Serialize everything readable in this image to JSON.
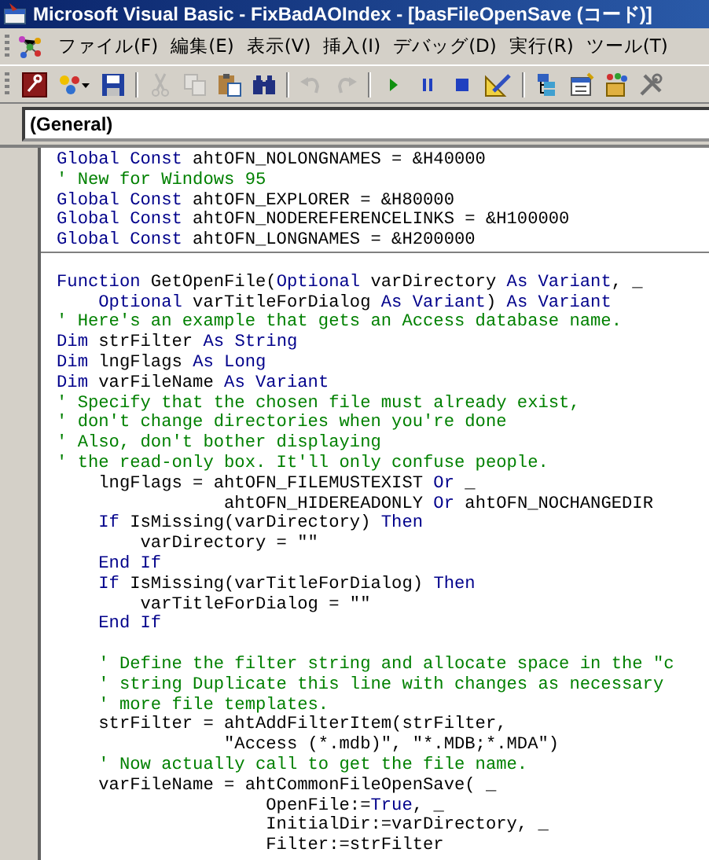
{
  "window": {
    "title": "Microsoft Visual Basic - FixBadAOIndex - [basFileOpenSave (コード)]"
  },
  "menu": [
    "ファイル(F)",
    "編集(E)",
    "表示(V)",
    "挿入(I)",
    "デバッグ(D)",
    "実行(R)",
    "ツール(T)"
  ],
  "toolbar": [
    {
      "kind": "access",
      "disabled": false
    },
    {
      "kind": "insert",
      "disabled": false
    },
    {
      "kind": "save",
      "disabled": false
    },
    {
      "kind": "sep"
    },
    {
      "kind": "cut",
      "disabled": true
    },
    {
      "kind": "copy",
      "disabled": true
    },
    {
      "kind": "paste",
      "disabled": false
    },
    {
      "kind": "find",
      "disabled": false
    },
    {
      "kind": "sep"
    },
    {
      "kind": "undo",
      "disabled": true
    },
    {
      "kind": "redo",
      "disabled": true
    },
    {
      "kind": "sep"
    },
    {
      "kind": "run",
      "disabled": false
    },
    {
      "kind": "pause",
      "disabled": false
    },
    {
      "kind": "stop",
      "disabled": false
    },
    {
      "kind": "design",
      "disabled": false
    },
    {
      "kind": "sep"
    },
    {
      "kind": "project",
      "disabled": false
    },
    {
      "kind": "properties",
      "disabled": false
    },
    {
      "kind": "browser",
      "disabled": false
    },
    {
      "kind": "toolbox",
      "disabled": false
    }
  ],
  "object_box": {
    "value": "(General)"
  },
  "sections": [
    {
      "lines": [
        {
          "tokens": [
            {
              "text": "Global Const",
              "kind": "keyword"
            },
            {
              "text": " ahtOFN_NOLONGNAMES = &H40000",
              "kind": "plain"
            }
          ]
        },
        {
          "tokens": [
            {
              "text": "' New for Windows 95",
              "kind": "comment"
            }
          ]
        },
        {
          "tokens": [
            {
              "text": "Global Const",
              "kind": "keyword"
            },
            {
              "text": " ahtOFN_EXPLORER = &H80000",
              "kind": "plain"
            }
          ]
        },
        {
          "tokens": [
            {
              "text": "Global Const",
              "kind": "keyword"
            },
            {
              "text": " ahtOFN_NODEREFERENCELINKS = &H100000",
              "kind": "plain"
            }
          ]
        },
        {
          "tokens": [
            {
              "text": "Global Const",
              "kind": "keyword"
            },
            {
              "text": " ahtOFN_LONGNAMES = &H200000",
              "kind": "plain"
            }
          ]
        }
      ]
    },
    {
      "lines": [
        {
          "blank": true
        },
        {
          "tokens": [
            {
              "text": "Function",
              "kind": "keyword"
            },
            {
              "text": " GetOpenFile(",
              "kind": "plain"
            },
            {
              "text": "Optional",
              "kind": "keyword"
            },
            {
              "text": " varDirectory ",
              "kind": "plain"
            },
            {
              "text": "As Variant",
              "kind": "keyword"
            },
            {
              "text": ", _",
              "kind": "plain"
            }
          ]
        },
        {
          "tokens": [
            {
              "text": "    Optional",
              "kind": "keyword"
            },
            {
              "text": " varTitleForDialog ",
              "kind": "plain"
            },
            {
              "text": "As Variant",
              "kind": "keyword"
            },
            {
              "text": ") ",
              "kind": "plain"
            },
            {
              "text": "As Variant",
              "kind": "keyword"
            }
          ]
        },
        {
          "tokens": [
            {
              "text": "' Here's an example that gets an Access database name.",
              "kind": "comment"
            }
          ]
        },
        {
          "tokens": [
            {
              "text": "Dim",
              "kind": "keyword"
            },
            {
              "text": " strFilter ",
              "kind": "plain"
            },
            {
              "text": "As String",
              "kind": "keyword"
            }
          ]
        },
        {
          "tokens": [
            {
              "text": "Dim",
              "kind": "keyword"
            },
            {
              "text": " lngFlags ",
              "kind": "plain"
            },
            {
              "text": "As Long",
              "kind": "keyword"
            }
          ]
        },
        {
          "tokens": [
            {
              "text": "Dim",
              "kind": "keyword"
            },
            {
              "text": " varFileName ",
              "kind": "plain"
            },
            {
              "text": "As Variant",
              "kind": "keyword"
            }
          ]
        },
        {
          "tokens": [
            {
              "text": "' Specify that the chosen file must already exist,",
              "kind": "comment"
            }
          ]
        },
        {
          "tokens": [
            {
              "text": "' don't change directories when you're done",
              "kind": "comment"
            }
          ]
        },
        {
          "tokens": [
            {
              "text": "' Also, don't bother displaying",
              "kind": "comment"
            }
          ]
        },
        {
          "tokens": [
            {
              "text": "' the read-only box. It'll only confuse people.",
              "kind": "comment"
            }
          ]
        },
        {
          "tokens": [
            {
              "text": "    lngFlags = ahtOFN_FILEMUSTEXIST ",
              "kind": "plain"
            },
            {
              "text": "Or",
              "kind": "keyword"
            },
            {
              "text": " _",
              "kind": "plain"
            }
          ]
        },
        {
          "tokens": [
            {
              "text": "                ahtOFN_HIDEREADONLY ",
              "kind": "plain"
            },
            {
              "text": "Or",
              "kind": "keyword"
            },
            {
              "text": " ahtOFN_NOCHANGEDIR",
              "kind": "plain"
            }
          ]
        },
        {
          "tokens": [
            {
              "text": "    If",
              "kind": "keyword"
            },
            {
              "text": " IsMissing(varDirectory) ",
              "kind": "plain"
            },
            {
              "text": "Then",
              "kind": "keyword"
            }
          ]
        },
        {
          "tokens": [
            {
              "text": "        varDirectory = \"\"",
              "kind": "plain"
            }
          ]
        },
        {
          "tokens": [
            {
              "text": "    End If",
              "kind": "keyword"
            }
          ]
        },
        {
          "tokens": [
            {
              "text": "    If",
              "kind": "keyword"
            },
            {
              "text": " IsMissing(varTitleForDialog) ",
              "kind": "plain"
            },
            {
              "text": "Then",
              "kind": "keyword"
            }
          ]
        },
        {
          "tokens": [
            {
              "text": "        varTitleForDialog = \"\"",
              "kind": "plain"
            }
          ]
        },
        {
          "tokens": [
            {
              "text": "    End If",
              "kind": "keyword"
            }
          ]
        },
        {
          "blank": true
        },
        {
          "tokens": [
            {
              "text": "    ' Define the filter string and allocate space in the \"c",
              "kind": "comment"
            }
          ]
        },
        {
          "tokens": [
            {
              "text": "    ' string Duplicate this line with changes as necessary",
              "kind": "comment"
            }
          ]
        },
        {
          "tokens": [
            {
              "text": "    ' more file templates.",
              "kind": "comment"
            }
          ]
        },
        {
          "tokens": [
            {
              "text": "    strFilter = ahtAddFilterItem(strFilter,",
              "kind": "plain"
            }
          ]
        },
        {
          "tokens": [
            {
              "text": "                \"Access (*.mdb)\", \"*.MDB;*.MDA\")",
              "kind": "plain"
            }
          ]
        },
        {
          "tokens": [
            {
              "text": "    ' Now actually call to get the file name.",
              "kind": "comment"
            }
          ]
        },
        {
          "tokens": [
            {
              "text": "    varFileName = ahtCommonFileOpenSave( _",
              "kind": "plain"
            }
          ]
        },
        {
          "tokens": [
            {
              "text": "                    OpenFile:=",
              "kind": "plain"
            },
            {
              "text": "True",
              "kind": "keyword"
            },
            {
              "text": ", _",
              "kind": "plain"
            }
          ]
        },
        {
          "tokens": [
            {
              "text": "                    InitialDir:=varDirectory, _",
              "kind": "plain"
            }
          ]
        },
        {
          "tokens": [
            {
              "text": "                    Filter:=strFilter",
              "kind": "plain"
            }
          ]
        }
      ]
    }
  ]
}
